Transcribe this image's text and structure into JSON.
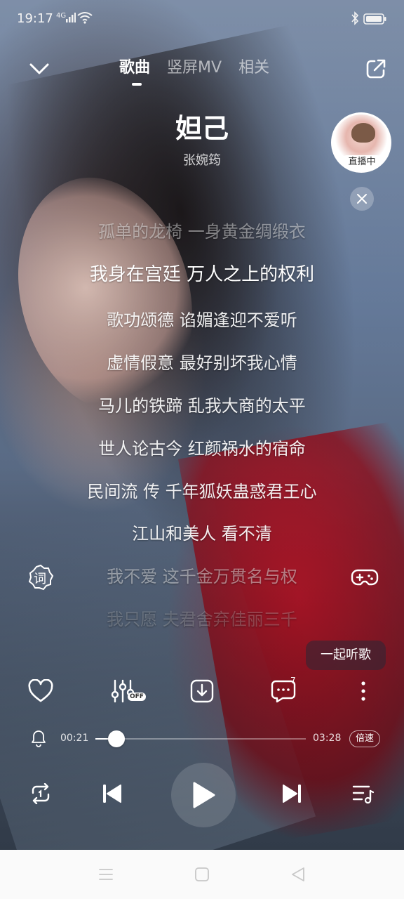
{
  "status_bar": {
    "time": "19:17",
    "network": "4G"
  },
  "top_nav": {
    "tabs": [
      {
        "label": "歌曲",
        "active": true
      },
      {
        "label": "竖屏MV",
        "active": false
      },
      {
        "label": "相关",
        "active": false
      }
    ]
  },
  "song": {
    "title": "妲己",
    "artist": "张婉筠"
  },
  "live": {
    "label": "直播中"
  },
  "lyrics": [
    "孤单的龙椅 一身黄金绸缎衣",
    "我身在宫廷 万人之上的权利",
    "歌功颂德 谄媚逢迎不爱听",
    "虚情假意 最好别坏我心情",
    "马儿的铁蹄 乱我大商的太平",
    "世人论古今 红颜祸水的宿命",
    "民间流 传 千年狐妖蛊惑君王心",
    "江山和美人 看不清",
    "我不爱 这千金万贯名与权",
    "我只愿 夫君舍弃佳丽三千"
  ],
  "current_lyric_index": 1,
  "side_buttons": {
    "lyrics_mode_label": "词"
  },
  "listen_together": {
    "label": "一起听歌"
  },
  "actions": {
    "effect_badge": "OFF",
    "comment_count": "7"
  },
  "progress": {
    "elapsed": "00:21",
    "total": "03:28",
    "fraction": 0.1,
    "speed_label": "倍速"
  },
  "icons": {
    "collapse": "chevron-down-icon",
    "share": "share-icon",
    "close": "close-icon",
    "like": "heart-icon",
    "effects": "equalizer-icon",
    "download": "download-icon",
    "comments": "comment-icon",
    "more": "more-vertical-icon",
    "alarm": "bell-icon",
    "repeat": "repeat-one-icon",
    "previous": "previous-icon",
    "play": "play-icon",
    "next": "next-icon",
    "playlist": "playlist-icon"
  }
}
